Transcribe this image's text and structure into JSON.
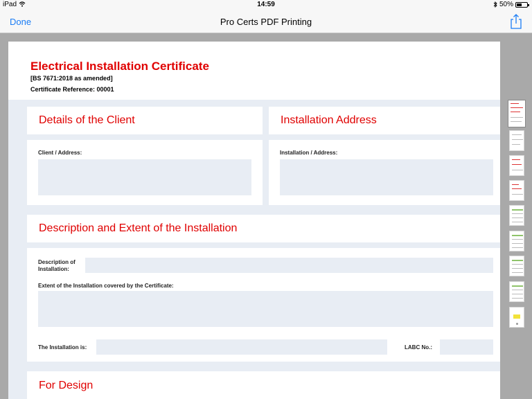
{
  "status": {
    "device": "iPad",
    "time": "14:59",
    "battery": "50%",
    "battery_level": 0.5
  },
  "nav": {
    "done": "Done",
    "title": "Pro Certs PDF Printing"
  },
  "doc": {
    "title": "Electrical Installation Certificate",
    "standard": "[BS 7671:2018 as amended]",
    "reference": "Certificate Reference: 00001"
  },
  "sections": {
    "client": {
      "title": "Details of the Client",
      "label": "Client / Address:"
    },
    "address": {
      "title": "Installation Address",
      "label": "Installation / Address:"
    },
    "description": {
      "title": "Description and Extent of the Installation",
      "desc_label_1": "Description of",
      "desc_label_2": "Installation:",
      "extent_label": "Extent of the Installation covered by the Certificate:",
      "installation_is_label": "The Installation is:",
      "labc_label": "LABC No.:"
    },
    "design": {
      "title": "For Design"
    }
  },
  "thumbnails": {
    "count": 9,
    "selected": 1
  }
}
